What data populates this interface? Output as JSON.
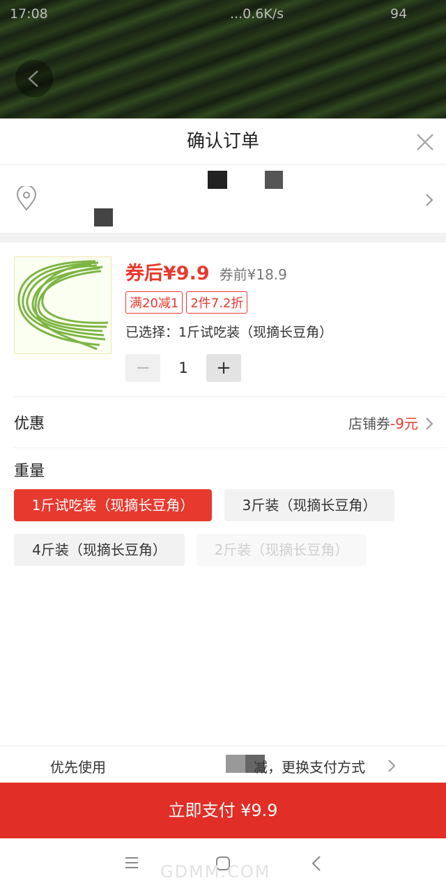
{
  "status_bar": {
    "time": "17:08",
    "network": "...0.6K/s",
    "battery": "94"
  },
  "sheet": {
    "title": "确认订单",
    "product": {
      "price_after": "券后¥9.9",
      "price_before": "券前¥18.9",
      "tags": [
        "满20减1",
        "2件7.2折"
      ],
      "selected_text": "已选择：1斤试吃装（现摘长豆角）",
      "quantity": "1",
      "minus": "−",
      "plus": "+"
    },
    "discount": {
      "label": "优惠",
      "value_prefix": "店铺券",
      "value_amount": "-9元"
    },
    "weight": {
      "label": "重量",
      "options": [
        {
          "label": "1斤试吃装（现摘长豆角）",
          "state": "selected"
        },
        {
          "label": "3斤装（现摘长豆角）",
          "state": "normal"
        },
        {
          "label": "4斤装（现摘长豆角）",
          "state": "normal"
        },
        {
          "label": "2斤装（现摘长豆角）",
          "state": "disabled"
        }
      ]
    },
    "payment": {
      "prefer_text": "优先使用",
      "change_text": "减，更换支付方式",
      "pay_button": "立即支付 ¥9.9"
    }
  },
  "colors": {
    "accent": "#e8392e",
    "pay_button": "#e12e26"
  },
  "icons": [
    "back-icon",
    "close-icon",
    "location-icon",
    "chevron-right-icon",
    "menu-icon",
    "home-icon",
    "nav-back-icon"
  ],
  "watermark": "GDMM.COM"
}
